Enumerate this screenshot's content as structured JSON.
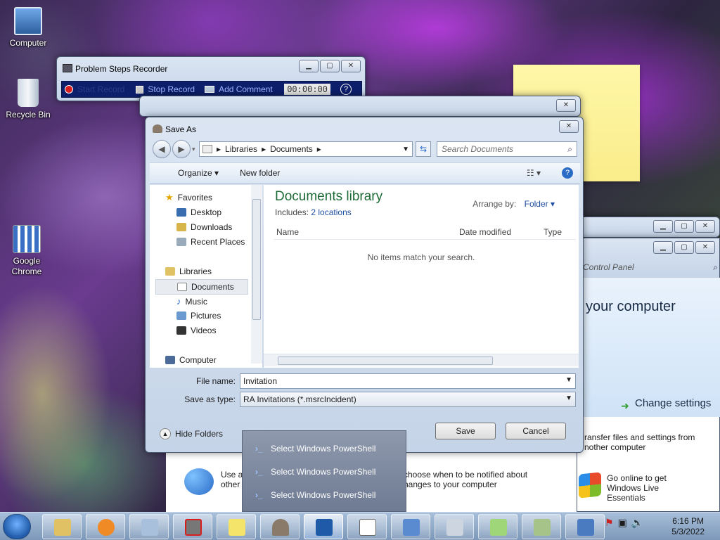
{
  "desktop": {
    "icons": [
      {
        "label": "Computer"
      },
      {
        "label": "Recycle Bin"
      },
      {
        "label": "Google Chrome"
      }
    ]
  },
  "psr": {
    "title": "Problem Steps Recorder",
    "start_label": "Start Record",
    "stop_label": "Stop Record",
    "comment_label": "Add Comment",
    "timer": "00:00:00"
  },
  "save_as": {
    "title": "Save As",
    "address": [
      "Libraries",
      "Documents"
    ],
    "search_placeholder": "Search Documents",
    "toolbar": {
      "organize": "Organize",
      "new_folder": "New folder"
    },
    "nav": {
      "favorites": "Favorites",
      "items": [
        "Desktop",
        "Downloads",
        "Recent Places"
      ],
      "libraries": "Libraries",
      "library_items": [
        "Documents",
        "Music",
        "Pictures",
        "Videos"
      ],
      "computer": "Computer"
    },
    "library": {
      "title": "Documents library",
      "includes_label": "Includes:",
      "includes_link": "2 locations",
      "arrange_label": "Arrange by:",
      "arrange_value": "Folder"
    },
    "columns": [
      "Name",
      "Date modified",
      "Type"
    ],
    "empty_text": "No items match your search.",
    "file_name_label": "File name:",
    "file_name_value": "Invitation",
    "save_type_label": "Save as type:",
    "save_type_value": "RA Invitations (*.msrcIncident)",
    "hide_folders": "Hide Folders",
    "save_button": "Save",
    "cancel_button": "Cancel"
  },
  "control_panel": {
    "search_text": "Control Panel",
    "heading": "your computer",
    "change_settings": "Change settings",
    "transfer_line1": "ransfer files and settings from",
    "transfer_line2": "nother computer",
    "live_line1": "Go online to get Windows Live",
    "live_line2": "Essentials"
  },
  "background": {
    "item1_line1": "Use a",
    "item1_line2": "other",
    "item2_line1": "choose when to be notified about",
    "item2_line2": "hanges to your computer"
  },
  "popup": {
    "items": [
      "Select Windows PowerShell",
      "Select Windows PowerShell",
      "Select Windows PowerShell"
    ]
  },
  "taskbar": {
    "time": "6:16 PM",
    "date": "5/3/2022"
  }
}
